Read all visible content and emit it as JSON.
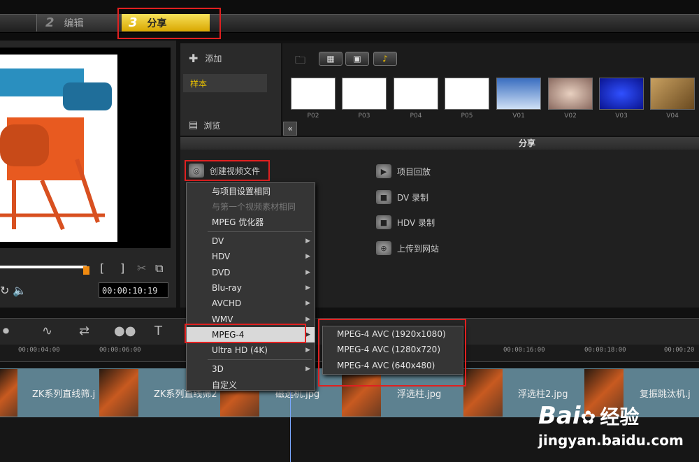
{
  "steps": {
    "edit_num": "2",
    "edit_label": "编辑",
    "share_num": "3",
    "share_label": "分享"
  },
  "preview": {
    "timecode": "00:00:10:19"
  },
  "library": {
    "add_label": "添加",
    "sample_label": "样本",
    "browse_label": "浏览",
    "thumbnails": [
      "P02",
      "P03",
      "P04",
      "P05",
      "V01",
      "V02",
      "V03",
      "V04"
    ]
  },
  "share": {
    "title": "分享",
    "create_video_label": "创建视频文件",
    "project_playback": "项目回放",
    "dv_record": "DV 录制",
    "hdv_record": "HDV 录制",
    "upload_web": "上传到网站"
  },
  "menu": {
    "items": [
      {
        "label": "与项目设置相同"
      },
      {
        "label": "与第一个视频素材相同"
      },
      {
        "label": "MPEG 优化器"
      },
      {
        "label": "DV"
      },
      {
        "label": "HDV"
      },
      {
        "label": "DVD"
      },
      {
        "label": "Blu-ray"
      },
      {
        "label": "AVCHD"
      },
      {
        "label": "WMV"
      },
      {
        "label": "MPEG-4"
      },
      {
        "label": "Ultra HD (4K)"
      },
      {
        "label": "3D"
      },
      {
        "label": "自定义"
      }
    ]
  },
  "submenu": {
    "items": [
      {
        "label": "MPEG-4 AVC (1920x1080)"
      },
      {
        "label": "MPEG-4 AVC (1280x720)"
      },
      {
        "label": "MPEG-4 AVC (640x480)"
      }
    ]
  },
  "timeline": {
    "ticks": [
      "00:00:04:00",
      "00:00:06:00",
      "00:00:16:00",
      "00:00:18:00",
      "00:00:20"
    ],
    "clips": [
      "ZK系列直线筛.j",
      "ZK系列直线筛2",
      "磁选机.jpg",
      "浮选柱.jpg",
      "浮选柱2.jpg",
      "复振跳汰机.j"
    ]
  },
  "watermark": {
    "brand": "Bai",
    "brand2": "经验",
    "url": "jingyan.baidu.com"
  }
}
